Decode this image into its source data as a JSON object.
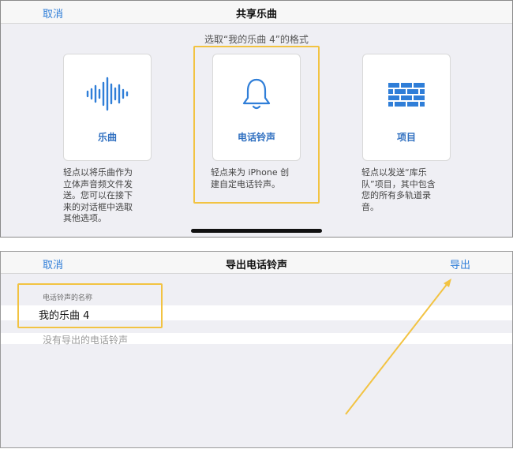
{
  "share": {
    "cancel_label": "取消",
    "title": "共享乐曲",
    "prompt": "选取“我的乐曲 4”的格式",
    "options": [
      {
        "label": "乐曲",
        "icon": "waveform-icon",
        "description": [
          "轻点以将乐曲作为",
          "立体声音频文件发",
          "送。您可以在接下",
          "来的对话框中选取",
          "其他选项。"
        ]
      },
      {
        "label": "电话铃声",
        "icon": "bell-icon",
        "description": [
          "轻点来为 iPhone 创",
          "建自定电话铃声。"
        ]
      },
      {
        "label": "项目",
        "icon": "bricks-icon",
        "description": [
          "轻点以发送“库乐",
          "队”项目，其中包含",
          "您的所有多轨道录",
          "音。"
        ]
      }
    ]
  },
  "export": {
    "cancel_label": "取消",
    "title": "导出电话铃声",
    "export_label": "导出",
    "name_caption": "电话铃声的名称",
    "name_value": "我的乐曲 4",
    "empty_text": "没有导出的电话铃声"
  },
  "colors": {
    "accent": "#2f7ed8",
    "highlight": "#f2c342",
    "background": "#efeff4"
  }
}
